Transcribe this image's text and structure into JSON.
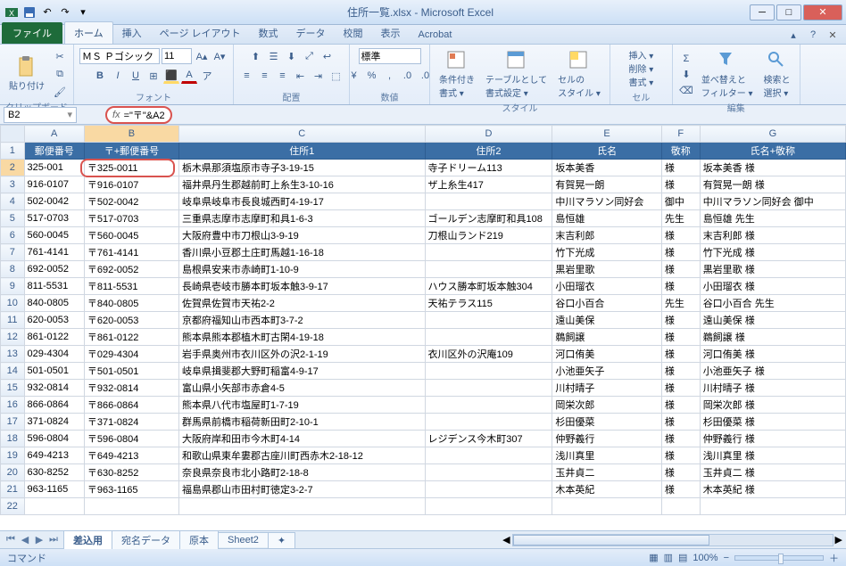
{
  "window": {
    "title": "住所一覧.xlsx - Microsoft Excel"
  },
  "tabs": {
    "file": "ファイル",
    "items": [
      "ホーム",
      "挿入",
      "ページ レイアウト",
      "数式",
      "データ",
      "校閲",
      "表示",
      "Acrobat"
    ],
    "active": 0
  },
  "ribbon": {
    "clipboard": {
      "paste": "貼り付け",
      "label": "クリップボード"
    },
    "font": {
      "name": "ＭＳ Ｐゴシック",
      "size": "11",
      "label": "フォント"
    },
    "align": {
      "label": "配置"
    },
    "number": {
      "format": "標準",
      "label": "数値"
    },
    "styles": {
      "cond": "条件付き\n書式 ▾",
      "table": "テーブルとして\n書式設定 ▾",
      "cell": "セルの\nスタイル ▾",
      "label": "スタイル"
    },
    "cells": {
      "insert": "挿入 ▾",
      "delete": "削除 ▾",
      "format": "書式 ▾",
      "label": "セル"
    },
    "editing": {
      "sort": "並べ替えと\nフィルター ▾",
      "find": "検索と\n選択 ▾",
      "label": "編集"
    }
  },
  "namebox": "B2",
  "formula": "=\"〒\"&A2",
  "columns": [
    "A",
    "B",
    "C",
    "D",
    "E",
    "F",
    "G"
  ],
  "header_row": [
    "郵便番号",
    "〒+郵便番号",
    "住所1",
    "住所2",
    "氏名",
    "敬称",
    "氏名+敬称"
  ],
  "rows": [
    [
      "325-001",
      "〒325-0011",
      "栃木県那須塩原市寺子3-19-15",
      "寺子ドリーム113",
      "坂本美香",
      "様",
      "坂本美香 様"
    ],
    [
      "916-0107",
      "〒916-0107",
      "福井県丹生郡越前町上糸生3-10-16",
      "ザ上糸生417",
      "有賀晃一朗",
      "様",
      "有賀晃一朗 様"
    ],
    [
      "502-0042",
      "〒502-0042",
      "岐阜県岐阜市長良城西町4-19-17",
      "",
      "中川マラソン同好会",
      "御中",
      "中川マラソン同好会 御中"
    ],
    [
      "517-0703",
      "〒517-0703",
      "三重県志摩市志摩町和具1-6-3",
      "ゴールデン志摩町和具108",
      "島恒雄",
      "先生",
      "島恒雄 先生"
    ],
    [
      "560-0045",
      "〒560-0045",
      "大阪府豊中市刀根山3-9-19",
      "刀根山ランド219",
      "末吉利郎",
      "様",
      "末吉利郎 様"
    ],
    [
      "761-4141",
      "〒761-4141",
      "香川県小豆郡土庄町馬越1-16-18",
      "",
      "竹下光成",
      "様",
      "竹下光成 様"
    ],
    [
      "692-0052",
      "〒692-0052",
      "島根県安来市赤崎町1-10-9",
      "",
      "黒岩里歌",
      "様",
      "黒岩里歌 様"
    ],
    [
      "811-5531",
      "〒811-5531",
      "長崎県壱岐市勝本町坂本触3-9-17",
      "ハウス勝本町坂本触304",
      "小田瑠衣",
      "様",
      "小田瑠衣 様"
    ],
    [
      "840-0805",
      "〒840-0805",
      "佐賀県佐賀市天祐2-2",
      "天祐テラス115",
      "谷口小百合",
      "先生",
      "谷口小百合 先生"
    ],
    [
      "620-0053",
      "〒620-0053",
      "京都府福知山市西本町3-7-2",
      "",
      "遠山美保",
      "様",
      "遠山美保 様"
    ],
    [
      "861-0122",
      "〒861-0122",
      "熊本県熊本郡植木町古閑4-19-18",
      "",
      "鵜飼譲",
      "様",
      "鵜飼譲 様"
    ],
    [
      "029-4304",
      "〒029-4304",
      "岩手県奥州市衣川区外の沢2-1-19",
      "衣川区外の沢庵109",
      "河口侑美",
      "様",
      "河口侑美 様"
    ],
    [
      "501-0501",
      "〒501-0501",
      "岐阜県揖斐郡大野町稲富4-9-17",
      "",
      "小池亜矢子",
      "様",
      "小池亜矢子 様"
    ],
    [
      "932-0814",
      "〒932-0814",
      "富山県小矢部市赤倉4-5",
      "",
      "川村晴子",
      "様",
      "川村晴子 様"
    ],
    [
      "866-0864",
      "〒866-0864",
      "熊本県八代市塩屋町1-7-19",
      "",
      "岡栄次郎",
      "様",
      "岡栄次郎 様"
    ],
    [
      "371-0824",
      "〒371-0824",
      "群馬県前橋市稲荷新田町2-10-1",
      "",
      "杉田優菜",
      "様",
      "杉田優菜 様"
    ],
    [
      "596-0804",
      "〒596-0804",
      "大阪府岸和田市今木町4-14",
      "レジデンス今木町307",
      "仲野義行",
      "様",
      "仲野義行 様"
    ],
    [
      "649-4213",
      "〒649-4213",
      "和歌山県東牟婁郡古座川町西赤木2-18-12",
      "",
      "浅川真里",
      "様",
      "浅川真里 様"
    ],
    [
      "630-8252",
      "〒630-8252",
      "奈良県奈良市北小路町2-18-8",
      "",
      "玉井貞二",
      "様",
      "玉井貞二 様"
    ],
    [
      "963-1165",
      "〒963-1165",
      "福島県郡山市田村町徳定3-2-7",
      "",
      "木本英紀",
      "様",
      "木本英紀 様"
    ]
  ],
  "sheets": [
    "差込用",
    "宛名データ",
    "原本",
    "Sheet2"
  ],
  "active_sheet": 0,
  "status": {
    "mode": "コマンド",
    "zoom": "100%"
  }
}
